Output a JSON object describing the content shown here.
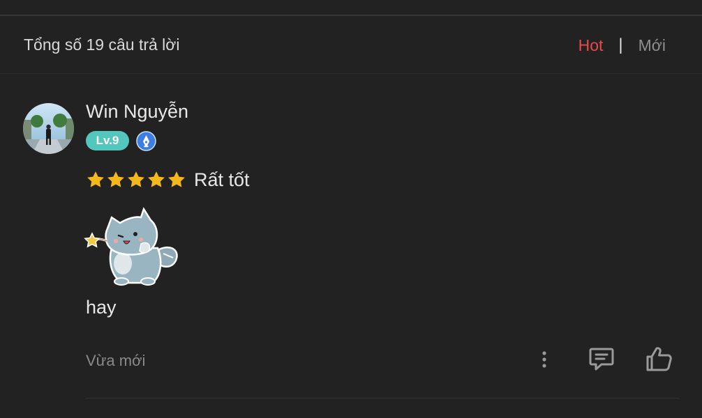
{
  "header": {
    "total_label": "Tổng số 19 câu trả lời",
    "sort_hot": "Hot",
    "sort_separator": "|",
    "sort_new": "Mới"
  },
  "comment": {
    "username": "Win Nguyễn",
    "level_badge": "Lv.9",
    "rating_stars": 5,
    "rating_label": "Rất tốt",
    "text": "hay",
    "time": "Vừa mới"
  },
  "colors": {
    "background": "#222222",
    "accent_red": "#e84a4a",
    "level_badge": "#53c6bd",
    "star": "#f5b81c",
    "verified_badge": "#3d7fe0"
  },
  "icons": [
    "avatar-photo",
    "verified-pen-icon",
    "star-icon",
    "cat-sticker",
    "more-vertical-icon",
    "comment-icon",
    "thumbs-up-icon"
  ]
}
